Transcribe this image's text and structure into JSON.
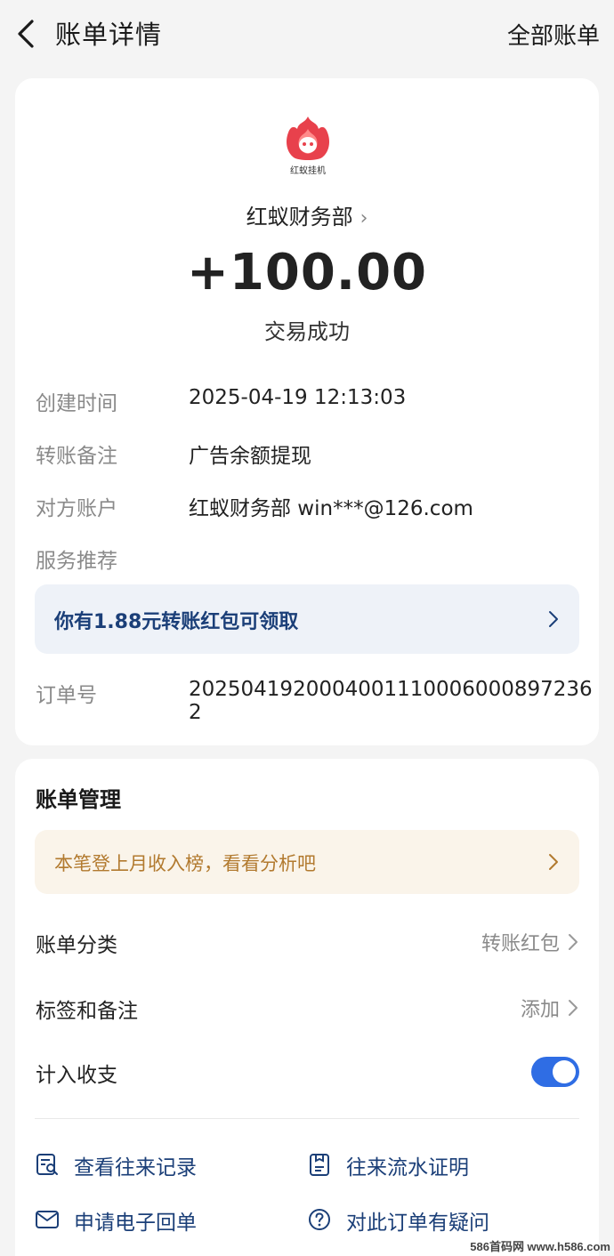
{
  "header": {
    "title": "账单详情",
    "right_link": "全部账单"
  },
  "merchant": {
    "logo_text": "红蚁挂机",
    "name": "红蚁财务部",
    "amount": "+100.00",
    "status": "交易成功"
  },
  "details": [
    {
      "label": "创建时间",
      "value": "2025-04-19 12:13:03"
    },
    {
      "label": "转账备注",
      "value": "广告余额提现"
    },
    {
      "label": "对方账户",
      "value": "红蚁财务部 win***@126.com"
    },
    {
      "label": "服务推荐",
      "value": ""
    }
  ],
  "promo": {
    "text": "你有1.88元转账红包可领取"
  },
  "order": {
    "label": "订单号",
    "value": "2025041920004001110006000897236​2"
  },
  "management": {
    "title": "账单管理",
    "tip": "本笔登上月收入榜，看看分析吧",
    "category_label": "账单分类",
    "category_value": "转账红包",
    "tags_label": "标签和备注",
    "tags_value": "添加",
    "include_label": "计入收支",
    "include_on": true
  },
  "actions": [
    {
      "label": "查看往来记录",
      "icon": "record-search-icon"
    },
    {
      "label": "往来流水证明",
      "icon": "document-proof-icon"
    },
    {
      "label": "申请电子回单",
      "icon": "mail-receipt-icon"
    },
    {
      "label": "对此订单有疑问",
      "icon": "question-icon"
    }
  ],
  "watermark": "586首码网 www.h586.com",
  "colors": {
    "accent_blue": "#2f6de4",
    "promo_text": "#1b3f78",
    "tip_text": "#b27a2f",
    "logo_red": "#e8414c"
  }
}
